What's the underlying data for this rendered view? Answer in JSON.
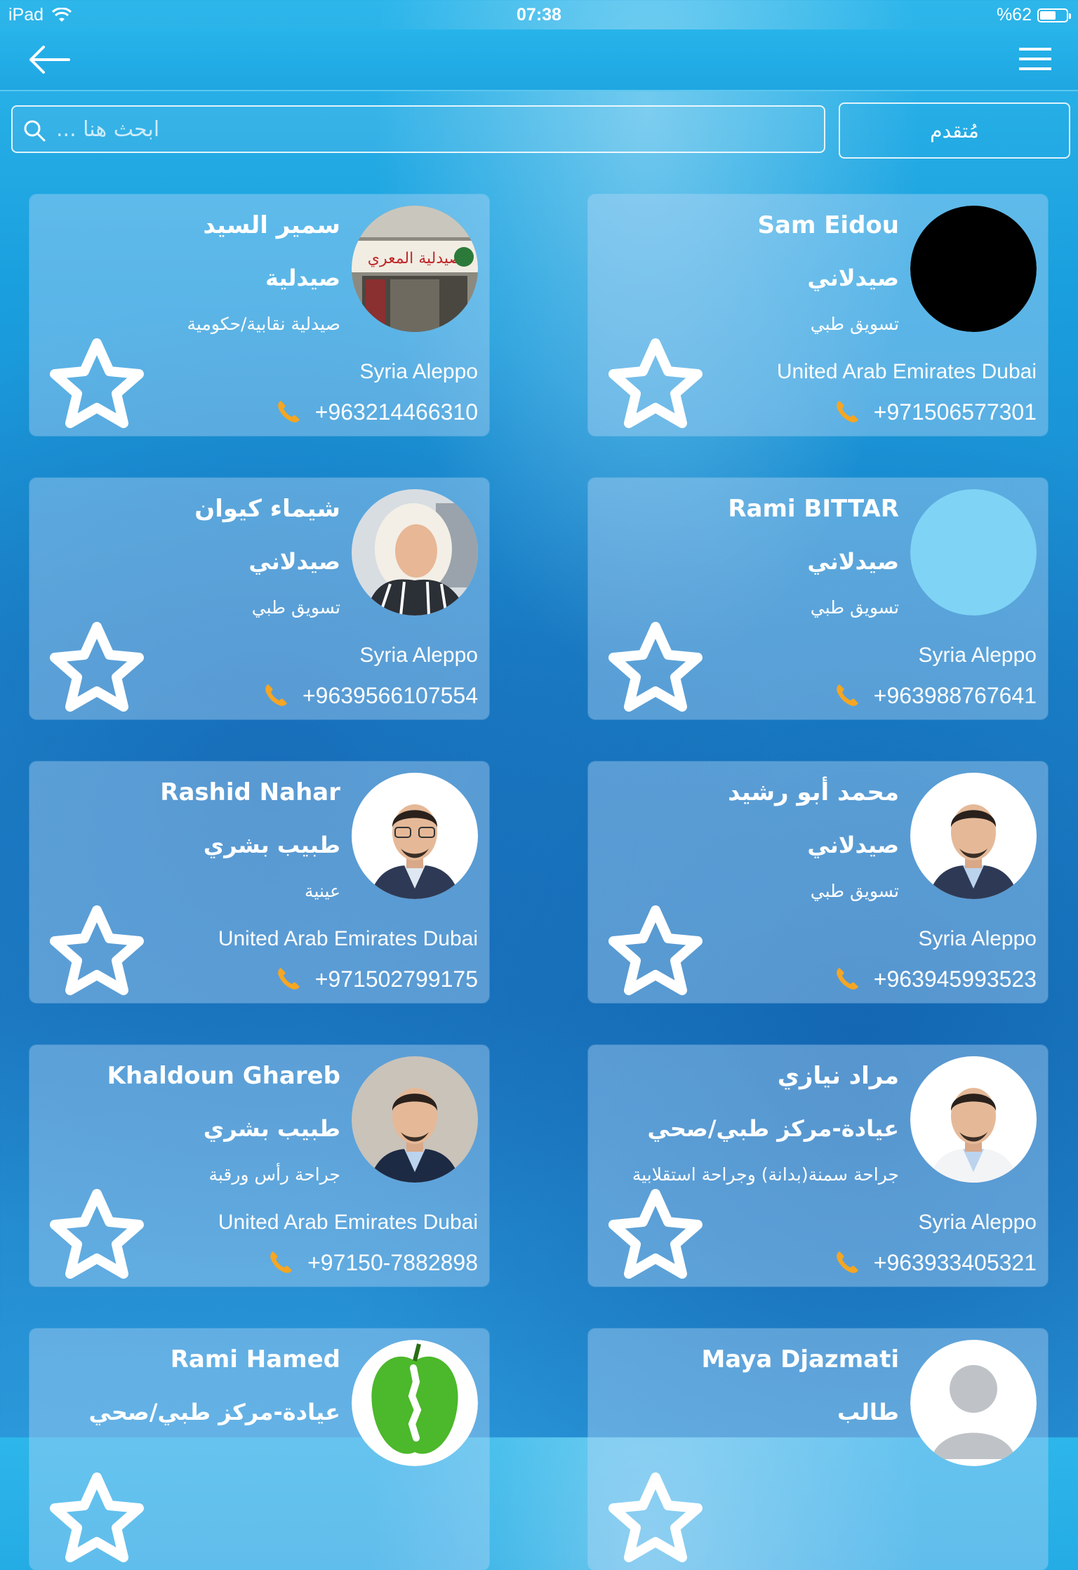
{
  "status_bar": {
    "device": "iPad",
    "time": "07:38",
    "battery": "%62",
    "battery_level": 0.62
  },
  "search": {
    "placeholder": "ابحث هنا ...",
    "value": ""
  },
  "advanced_label": "مُتقدم",
  "cards": [
    {
      "name": "Sam Eidou",
      "title": "صيدلاني",
      "subtitle": "تسويق طبي",
      "location": "United Arab Emirates Dubai",
      "phone": "+971506577301",
      "avatar": "black-circle"
    },
    {
      "name": "سمير السيد",
      "title": "صيدلية",
      "subtitle": "صيدلية نقابية/حكومية",
      "location": "Syria Aleppo",
      "phone": "+963214466310",
      "avatar": "pharmacy-storefront-photo"
    },
    {
      "name": "Rami BITTAR",
      "title": "صيدلاني",
      "subtitle": "تسويق طبي",
      "location": "Syria Aleppo",
      "phone": "+963988767641",
      "avatar": "empty-circle"
    },
    {
      "name": "شيماء كيوان",
      "title": "صيدلاني",
      "subtitle": "تسويق طبي",
      "location": "Syria Aleppo",
      "phone": "+9639566107554",
      "avatar": "woman-hijab-photo"
    },
    {
      "name": "محمد أبو رشيد",
      "title": "صيدلاني",
      "subtitle": "تسويق طبي",
      "location": "Syria Aleppo",
      "phone": "+963945993523",
      "avatar": "man-portrait-photo"
    },
    {
      "name": "Rashid Nahar",
      "title": "طبيب بشري",
      "subtitle": "عينية",
      "location": "United Arab Emirates Dubai",
      "phone": "+971502799175",
      "avatar": "man-glasses-photo"
    },
    {
      "name": "مراد نيازي",
      "title": "عيادة-مركز طبي/صحي",
      "subtitle": "جراحة سمنة(بدانة) وجراحة استقلابية",
      "location": "Syria Aleppo",
      "phone": "+963933405321",
      "avatar": "doctor-coat-photo"
    },
    {
      "name": "Khaldoun Ghareb",
      "title": "طبيب بشري",
      "subtitle": "جراحة رأس ورقبة",
      "location": "United Arab Emirates Dubai",
      "phone": "+97150-7882898",
      "avatar": "man-suit-photo"
    },
    {
      "name": "Maya Djazmati",
      "title": "طالب",
      "subtitle": "",
      "location": "",
      "phone": "",
      "avatar": "default-user-avatar"
    },
    {
      "name": "Rami Hamed",
      "title": "عيادة-مركز طبي/صحي",
      "subtitle": "",
      "location": "",
      "phone": "",
      "avatar": "green-apple-spine-logo"
    }
  ]
}
